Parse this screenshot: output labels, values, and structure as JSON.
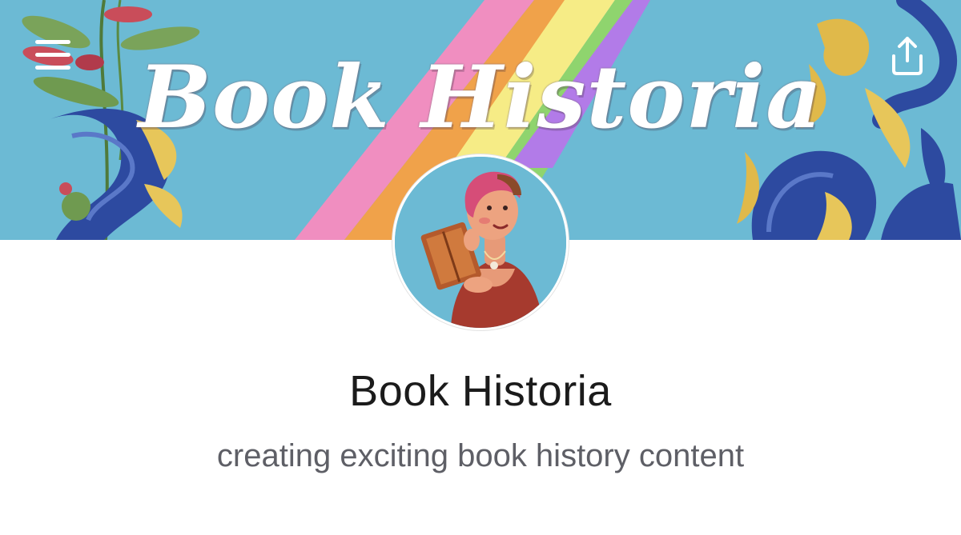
{
  "banner": {
    "title": "Book Historia",
    "background_color": "#6cbad4",
    "rainbow_colors": [
      "#f08ec0",
      "#f0a24a",
      "#f6ec86",
      "#8fd46e",
      "#b27be8"
    ]
  },
  "header": {
    "menu_icon": "hamburger-menu-icon",
    "share_icon": "share-upload-icon"
  },
  "profile": {
    "name": "Book Historia",
    "tagline": "creating exciting book history content",
    "avatar_icon": "illustrated-reader-avatar"
  },
  "colors": {
    "name_text": "#1b1b1b",
    "tagline_text": "#5e5f66"
  }
}
